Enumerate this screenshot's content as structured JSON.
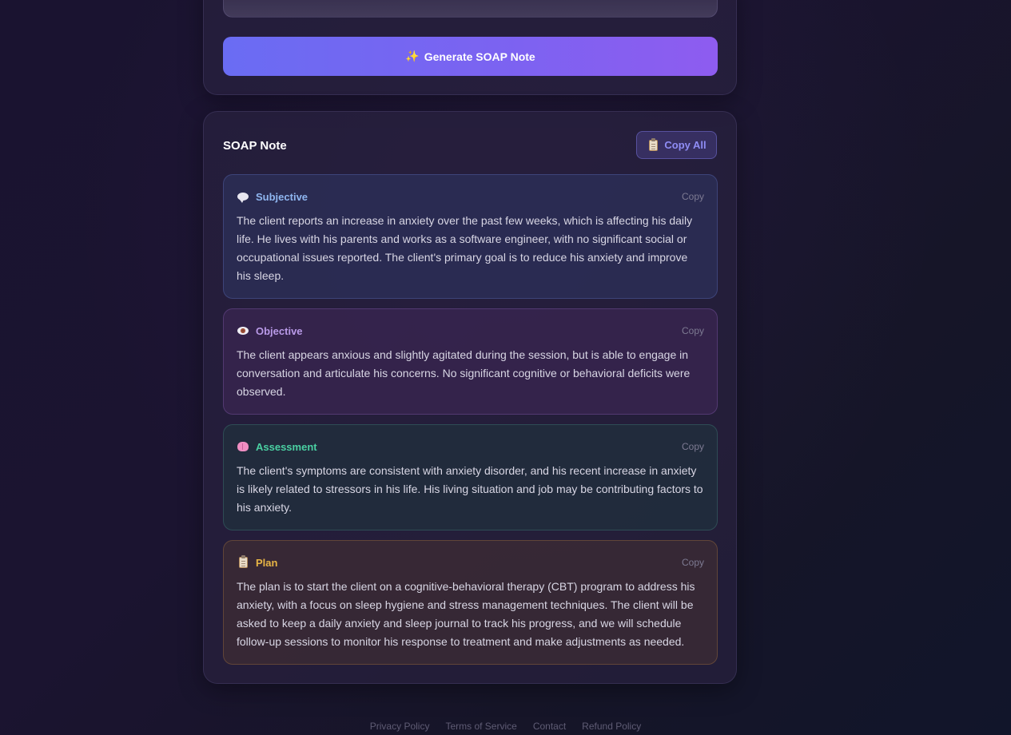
{
  "generate": {
    "icon": "sparkles-icon",
    "label": "Generate SOAP Note"
  },
  "soap": {
    "title": "SOAP Note",
    "copy_all_label": "Copy All",
    "sections": {
      "subjective": {
        "icon": "speech-bubble-icon",
        "title": "Subjective",
        "copy": "Copy",
        "text": "The client reports an increase in anxiety over the past few weeks, which is affecting his daily life. He lives with his parents and works as a software engineer, with no significant social or occupational issues reported. The client's primary goal is to reduce his anxiety and improve his sleep."
      },
      "objective": {
        "icon": "eye-icon",
        "title": "Objective",
        "copy": "Copy",
        "text": "The client appears anxious and slightly agitated during the session, but is able to engage in conversation and articulate his concerns. No significant cognitive or behavioral deficits were observed."
      },
      "assessment": {
        "icon": "brain-icon",
        "title": "Assessment",
        "copy": "Copy",
        "text": "The client's symptoms are consistent with anxiety disorder, and his recent increase in anxiety is likely related to stressors in his life. His living situation and job may be contributing factors to his anxiety."
      },
      "plan": {
        "icon": "clipboard-icon",
        "title": "Plan",
        "copy": "Copy",
        "text": "The plan is to start the client on a cognitive-behavioral therapy (CBT) program to address his anxiety, with a focus on sleep hygiene and stress management techniques. The client will be asked to keep a daily anxiety and sleep journal to track his progress, and we will schedule follow-up sessions to monitor his response to treatment and make adjustments as needed."
      }
    }
  },
  "footer": {
    "links": [
      "Privacy Policy",
      "Terms of Service",
      "Contact",
      "Refund Policy"
    ]
  },
  "colors": {
    "accent": "#6a6cf3",
    "subjective": "#8fb6f0",
    "objective": "#b99ae8",
    "assessment": "#4ad0a2",
    "plan": "#e7b545"
  }
}
